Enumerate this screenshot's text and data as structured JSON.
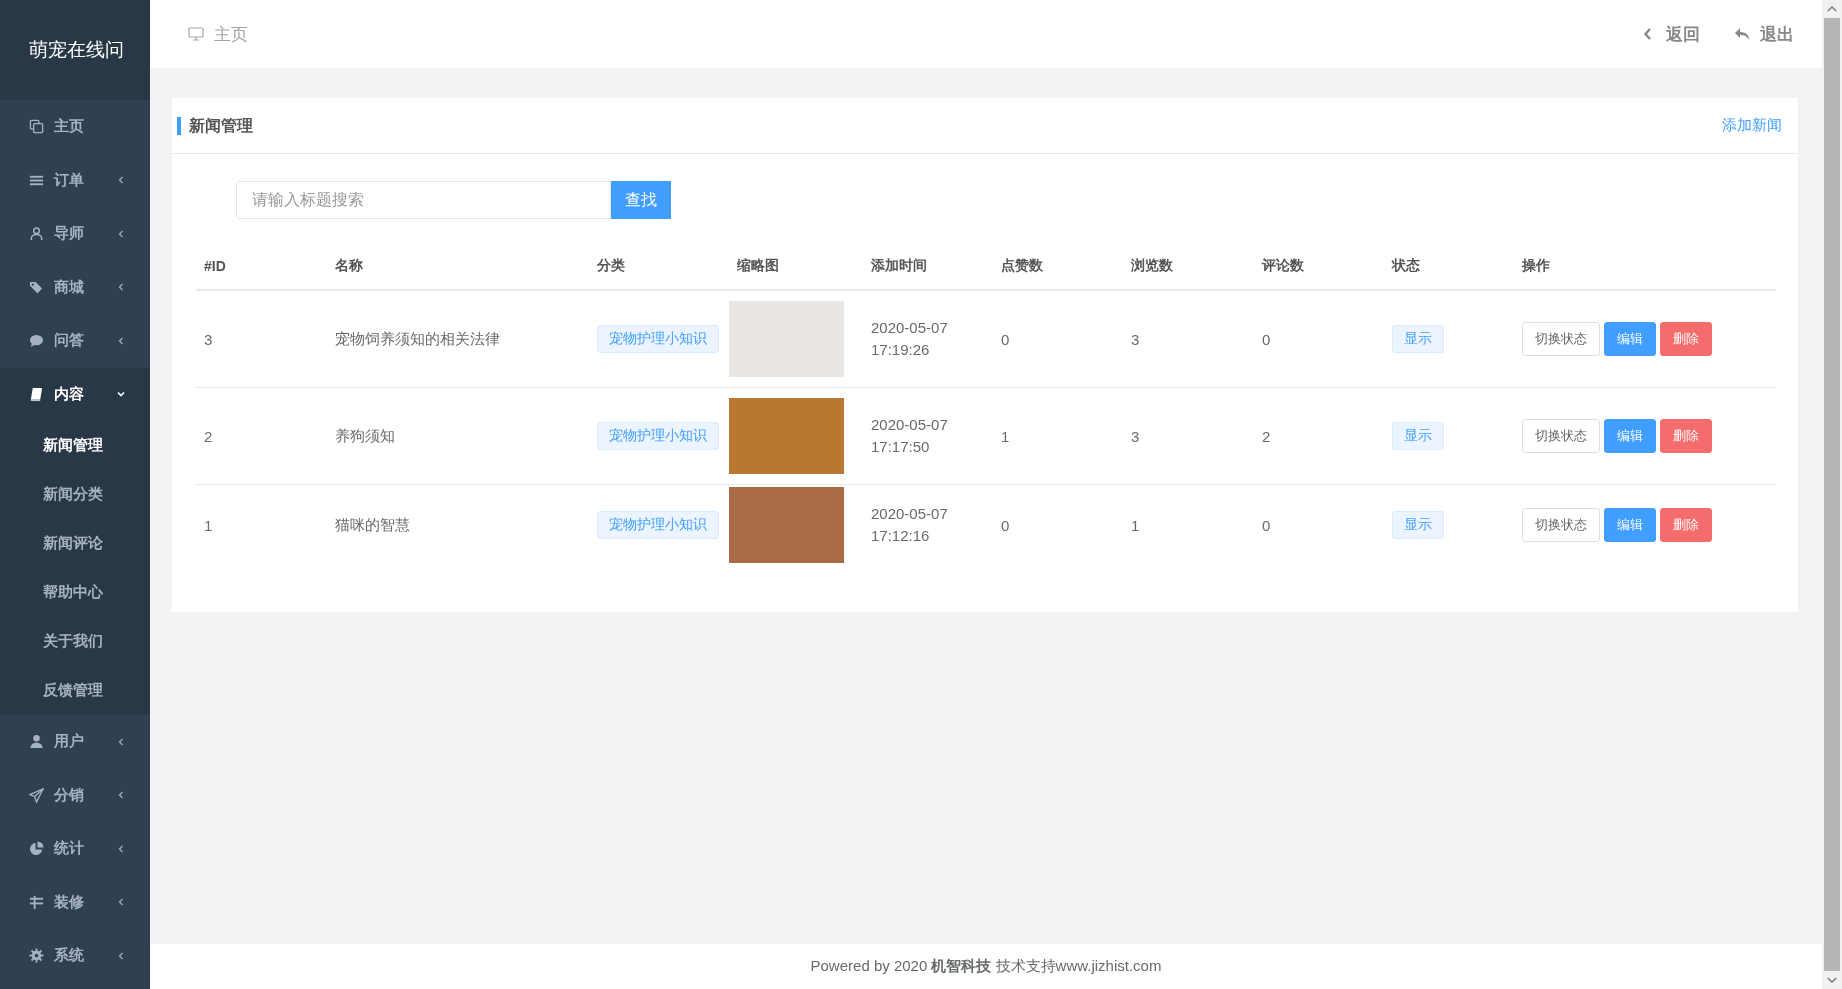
{
  "app_title": "萌宠在线问",
  "sidebar": {
    "items": [
      {
        "label": "主页",
        "kind": "link"
      },
      {
        "label": "订单",
        "kind": "menu",
        "expanded": false
      },
      {
        "label": "导师",
        "kind": "menu",
        "expanded": false
      },
      {
        "label": "商城",
        "kind": "menu",
        "expanded": false
      },
      {
        "label": "问答",
        "kind": "menu",
        "expanded": false
      },
      {
        "label": "内容",
        "kind": "menu",
        "expanded": true,
        "children": [
          {
            "label": "新闻管理",
            "selected": true
          },
          {
            "label": "新闻分类",
            "selected": false
          },
          {
            "label": "新闻评论",
            "selected": false
          },
          {
            "label": "帮助中心",
            "selected": false
          },
          {
            "label": "关于我们",
            "selected": false
          },
          {
            "label": "反馈管理",
            "selected": false
          }
        ]
      },
      {
        "label": "用户",
        "kind": "menu",
        "expanded": false
      },
      {
        "label": "分销",
        "kind": "menu",
        "expanded": false
      },
      {
        "label": "统计",
        "kind": "menu",
        "expanded": false
      },
      {
        "label": "装修",
        "kind": "menu",
        "expanded": false
      },
      {
        "label": "系统",
        "kind": "menu",
        "expanded": false
      }
    ]
  },
  "header": {
    "breadcrumb": "主页",
    "back": "返回",
    "logout": "退出"
  },
  "panel": {
    "title": "新闻管理",
    "add_link": "添加新闻",
    "search": {
      "placeholder": "请输入标题搜索",
      "button": "查找"
    },
    "table": {
      "columns": [
        "#ID",
        "名称",
        "分类",
        "缩略图",
        "添加时间",
        "点赞数",
        "浏览数",
        "评论数",
        "状态",
        "操作"
      ],
      "rows": [
        {
          "id": "3",
          "name": "宠物饲养须知的相关法律",
          "category": "宠物护理小知识",
          "added": "2020-05-07 17:19:26",
          "likes": "0",
          "views": "3",
          "comments": "0",
          "status": "显示",
          "actions": [
            {
              "label": "切换状态",
              "kind": "default"
            },
            {
              "label": "编辑",
              "kind": "primary"
            },
            {
              "label": "删除",
              "kind": "danger"
            }
          ]
        },
        {
          "id": "2",
          "name": "养狗须知",
          "category": "宠物护理小知识",
          "added": "2020-05-07 17:17:50",
          "likes": "1",
          "views": "3",
          "comments": "2",
          "status": "显示",
          "actions": [
            {
              "label": "切换状态",
              "kind": "default"
            },
            {
              "label": "编辑",
              "kind": "primary"
            },
            {
              "label": "删除",
              "kind": "danger"
            }
          ]
        },
        {
          "id": "1",
          "name": "猫咪的智慧",
          "category": "宠物护理小知识",
          "added": "2020-05-07 17:12:16",
          "likes": "0",
          "views": "1",
          "comments": "0",
          "status": "显示",
          "actions": [
            {
              "label": "切换状态",
              "kind": "default"
            },
            {
              "label": "编辑",
              "kind": "primary"
            },
            {
              "label": "删除",
              "kind": "danger"
            }
          ]
        }
      ]
    }
  },
  "footer": "Powered by 2020 **机智科技** 技术支持www.jizhist.com"
}
